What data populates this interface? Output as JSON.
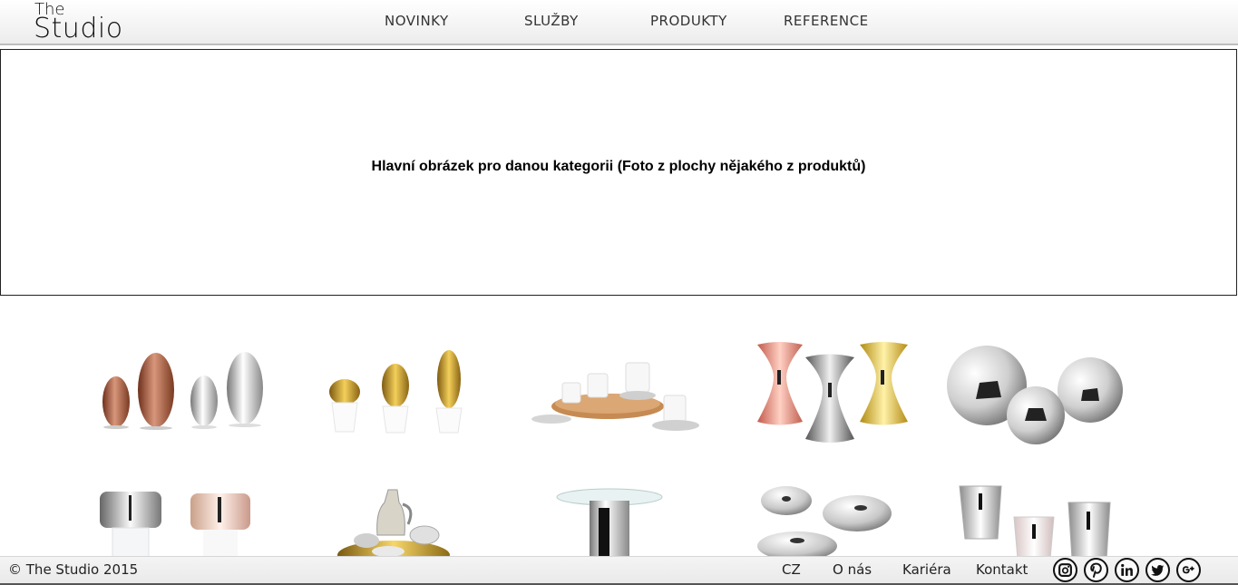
{
  "header": {
    "logo_small": "The",
    "logo_big": "Studio",
    "nav": [
      {
        "label": "NOVINKY"
      },
      {
        "label": "SLUŽBY"
      },
      {
        "label": "PRODUKTY"
      },
      {
        "label": "REFERENCE"
      }
    ]
  },
  "hero": {
    "text": "Hlavní obrázek pro danou kategorii (Foto z plochy nějakého z produktů)"
  },
  "products": [
    {
      "name": "copper-silver-egg-vases"
    },
    {
      "name": "gold-cactus-pots"
    },
    {
      "name": "candle-tray-set"
    },
    {
      "name": "hourglass-stools"
    },
    {
      "name": "silver-spheres"
    },
    {
      "name": "lamps"
    },
    {
      "name": "gold-tea-set"
    },
    {
      "name": "glass-side-table"
    },
    {
      "name": "silver-pebbles"
    },
    {
      "name": "silver-vessels"
    }
  ],
  "footer": {
    "copyright": "© The Studio 2015",
    "links": [
      {
        "label": "CZ"
      },
      {
        "label": "O nás"
      },
      {
        "label": "Kariéra"
      },
      {
        "label": "Kontakt"
      }
    ],
    "social": [
      {
        "icon": "instagram-icon"
      },
      {
        "icon": "pinterest-icon"
      },
      {
        "icon": "linkedin-icon"
      },
      {
        "icon": "twitter-icon"
      },
      {
        "icon": "google-plus-icon"
      }
    ]
  },
  "colors": {
    "copper": "#b5664a",
    "silver": "#c9c9c9",
    "gold": "#d8a72a",
    "rose": "#e79a8a",
    "wood": "#c68b52"
  }
}
